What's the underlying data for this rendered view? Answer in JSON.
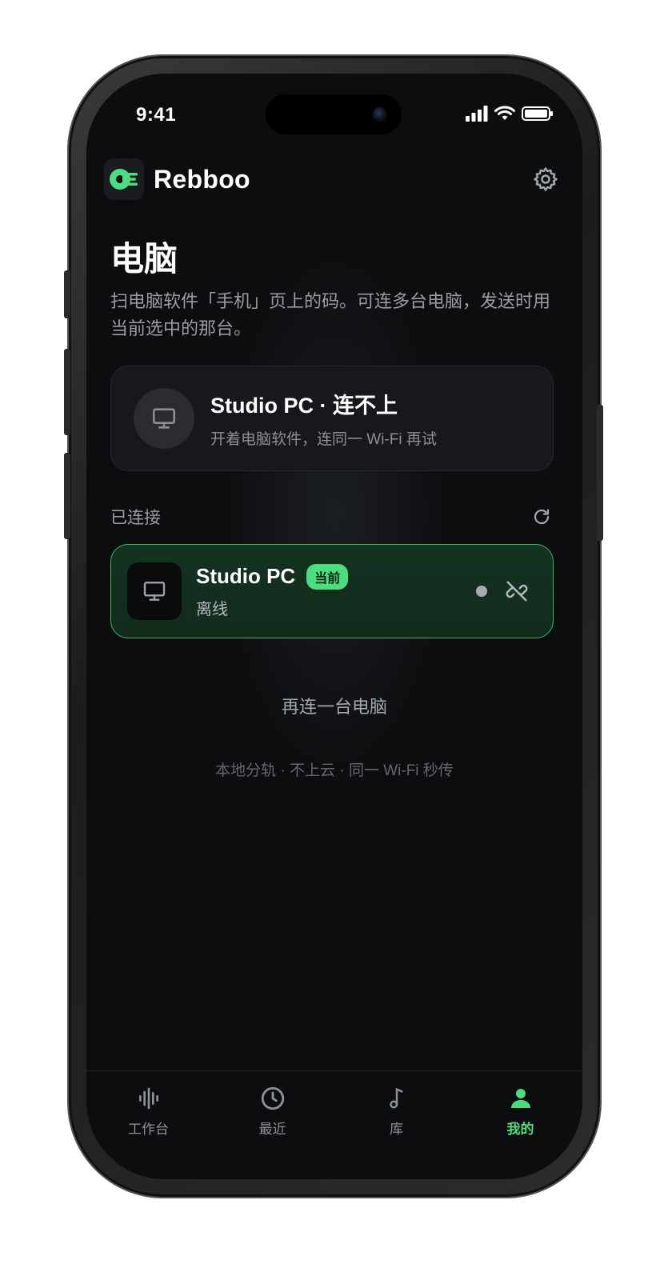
{
  "status_bar": {
    "time": "9:41"
  },
  "app": {
    "name": "Rebboo",
    "accent": "#4ade80"
  },
  "page": {
    "title": "电脑",
    "description": "扫电脑软件「手机」页上的码。可连多台电脑，发送时用当前选中的那台。"
  },
  "status_card": {
    "title": "Studio PC · 连不上",
    "subtitle": "开着电脑软件，连同一 Wi-Fi 再试",
    "icon": "monitor-icon"
  },
  "connected_section": {
    "label": "已连接",
    "devices": [
      {
        "name": "Studio PC",
        "badge": "当前",
        "status": "离线",
        "icon": "monitor-icon"
      }
    ]
  },
  "add_more": "再连一台电脑",
  "footer_note": "本地分轨 · 不上云 · 同一 Wi-Fi 秒传",
  "tabs": [
    {
      "label": "工作台",
      "icon": "waveform-icon",
      "active": false
    },
    {
      "label": "最近",
      "icon": "clock-icon",
      "active": false
    },
    {
      "label": "库",
      "icon": "music-note-icon",
      "active": false
    },
    {
      "label": "我的",
      "icon": "person-icon",
      "active": true
    }
  ]
}
